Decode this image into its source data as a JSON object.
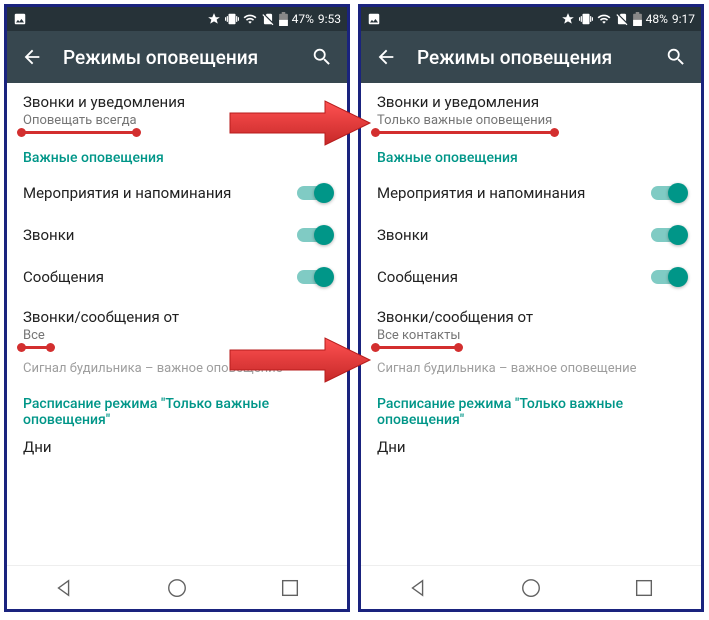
{
  "left": {
    "status": {
      "battery": "47%",
      "time": "9:53"
    },
    "title": "Режимы оповещения",
    "item1": {
      "primary": "Звонки и уведомления",
      "secondary": "Оповещать всегда"
    },
    "section1": "Важные оповещения",
    "toggles": [
      {
        "label": "Мероприятия и напоминания"
      },
      {
        "label": "Звонки"
      },
      {
        "label": "Сообщения"
      }
    ],
    "item2": {
      "primary": "Звонки/сообщения от",
      "secondary": "Все"
    },
    "hint": "Сигнал будильника – важное оповещение",
    "section2": "Расписание режима \"Только важные оповещения\"",
    "item3": "Дни"
  },
  "right": {
    "status": {
      "battery": "48%",
      "time": "9:17"
    },
    "title": "Режимы оповещения",
    "item1": {
      "primary": "Звонки и уведомления",
      "secondary": "Только важные оповещения"
    },
    "section1": "Важные оповещения",
    "toggles": [
      {
        "label": "Мероприятия и напоминания"
      },
      {
        "label": "Звонки"
      },
      {
        "label": "Сообщения"
      }
    ],
    "item2": {
      "primary": "Звонки/сообщения от",
      "secondary": "Все контакты"
    },
    "hint": "Сигнал будильника – важное оповещение",
    "section2": "Расписание режима \"Только важные оповещения\"",
    "item3": "Дни"
  }
}
